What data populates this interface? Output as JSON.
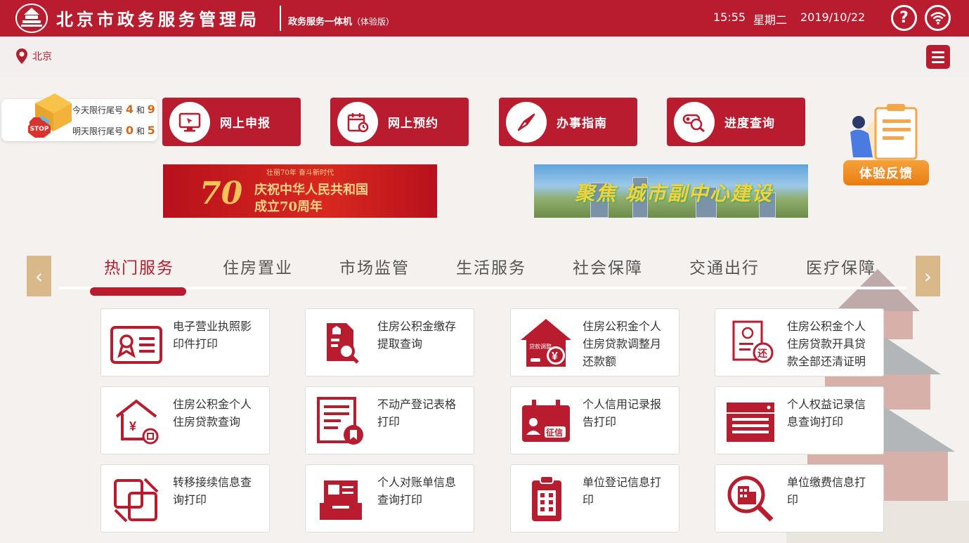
{
  "header": {
    "title": "北京市政务服务管理局",
    "subtitle": "政务服务一体机",
    "subtitle_note": "（体验版）",
    "time": "15:55",
    "weekday": "星期二",
    "date": "2019/10/22",
    "help_symbol": "?"
  },
  "location": {
    "city": "北京"
  },
  "traffic": {
    "today_label": "今天限行尾号",
    "today_a": "4",
    "today_and": "和",
    "today_b": "9",
    "tomorrow_label": "明天限行尾号",
    "tomorrow_a": "0",
    "tomorrow_and": "和",
    "tomorrow_b": "5",
    "stop_sign": "STOP"
  },
  "quick": [
    {
      "label": "网上申报"
    },
    {
      "label": "网上预约"
    },
    {
      "label": "办事指南"
    },
    {
      "label": "进度查询"
    }
  ],
  "feedback": {
    "label": "体验反馈"
  },
  "banners": {
    "b1_top": "壮丽70年 奋斗新时代",
    "b1_line1": "庆祝中华人民共和国",
    "b1_line2": "成立70周年",
    "b1_big": "70",
    "b2_text": "聚焦 城市副中心建设"
  },
  "arrows": {
    "prev": "‹",
    "next": "›"
  },
  "tabs": [
    {
      "label": "热门服务"
    },
    {
      "label": "住房置业"
    },
    {
      "label": "市场监管"
    },
    {
      "label": "生活服务"
    },
    {
      "label": "社会保障"
    },
    {
      "label": "交通出行"
    },
    {
      "label": "医疗保障"
    }
  ],
  "services": [
    {
      "line1": "电子营业执照影",
      "line2": "印件打印",
      "line3": ""
    },
    {
      "line1": "住房公积金缴存",
      "line2": "提取查询",
      "line3": ""
    },
    {
      "line1": "住房公积金个人",
      "line2": "住房贷款调整月",
      "line3": "还款额"
    },
    {
      "line1": "住房公积金个人",
      "line2": "住房贷款开具贷",
      "line3": "款全部还清证明"
    },
    {
      "line1": "住房公积金个人",
      "line2": "住房贷款查询",
      "line3": ""
    },
    {
      "line1": "不动产登记表格",
      "line2": "打印",
      "line3": ""
    },
    {
      "line1": "个人信用记录报",
      "line2": "告打印",
      "line3": ""
    },
    {
      "line1": "个人权益记录信",
      "line2": "息查询打印",
      "line3": ""
    },
    {
      "line1": "转移接续信息查",
      "line2": "询打印",
      "line3": ""
    },
    {
      "line1": "个人对账单信息",
      "line2": "查询打印",
      "line3": ""
    },
    {
      "line1": "单位登记信息打",
      "line2": "印",
      "line3": ""
    },
    {
      "line1": "单位缴费信息打",
      "line2": "印",
      "line3": ""
    }
  ],
  "icon_labels": {
    "loan_adjust": "贷款调整",
    "repay": "还",
    "credit": "征信",
    "yuan": "¥"
  },
  "colors": {
    "brand": "#b91c2e",
    "accent_orange": "#e87d14",
    "arrow_bg": "#d9b98a"
  }
}
